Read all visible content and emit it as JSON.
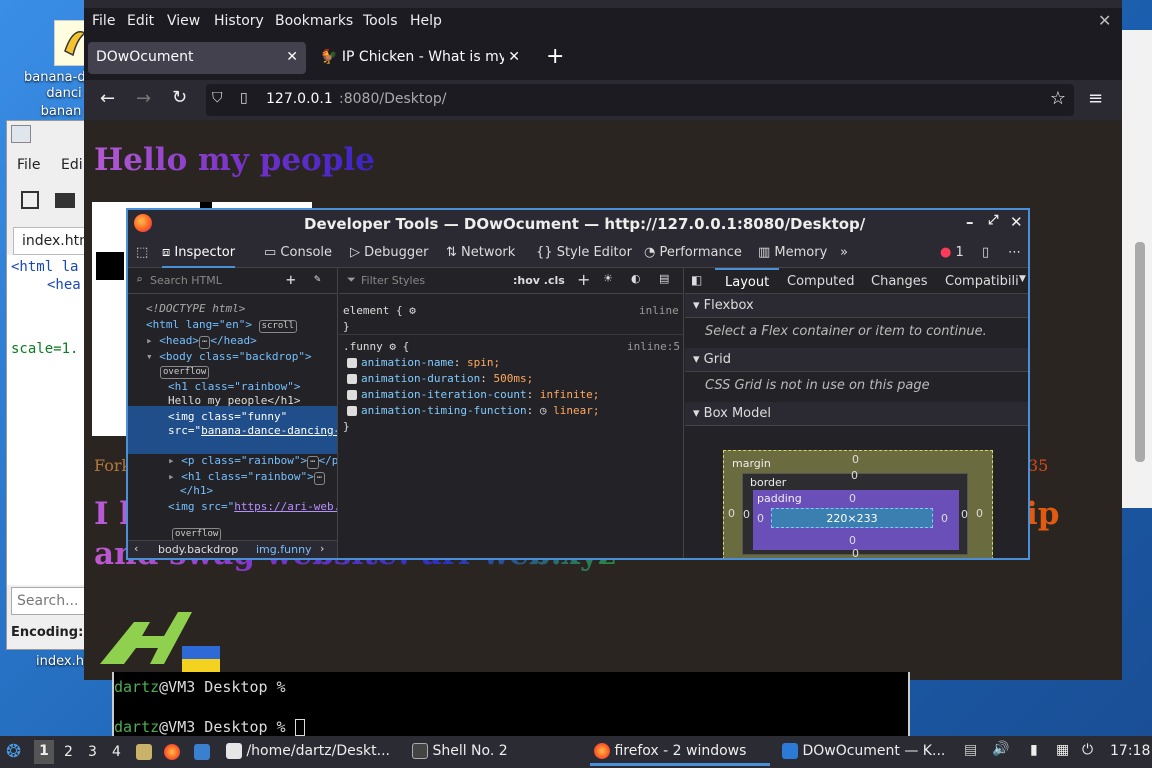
{
  "desktop": {
    "icon_label_1": "banana-dance-",
    "icon_label_2": "danci",
    "icon_label_3": "banan"
  },
  "kate": {
    "menu_file": "File",
    "menu_edit": "Edi",
    "tab_label": "index.htm",
    "code_line_1": "<html la",
    "code_line_2": "<hea",
    "code_line_3": "scale=1.",
    "search_placeholder": "Search...",
    "encoding_label": "Encoding:",
    "bottom_label": "index.htm"
  },
  "firefox": {
    "menu": [
      "File",
      "Edit",
      "View",
      "History",
      "Bookmarks",
      "Tools",
      "Help"
    ],
    "tabs": [
      {
        "label": "DOwOcument"
      },
      {
        "label": "IP Chicken - What is my I"
      }
    ],
    "url_host": "127.0.0.1",
    "url_rest": ":8080/Desktop/",
    "page": {
      "heading": "Hello my people",
      "fork_text": "Fork",
      "fork_suffix": "35",
      "big_text_left": "I l",
      "big_text_right": "ip",
      "bottom_text": "and swag website! ari-web.xyz"
    }
  },
  "devtools": {
    "title": "Developer Tools — DOwOcument — http://127.0.0.1:8080/Desktop/",
    "tabs": [
      "Inspector",
      "Console",
      "Debugger",
      "Network",
      "Style Editor",
      "Performance",
      "Memory"
    ],
    "error_count": "1",
    "search_html_placeholder": "Search HTML",
    "filter_styles_placeholder": "Filter Styles",
    "hov_cls": ":hov .cls",
    "layout_tabs": [
      "Layout",
      "Computed",
      "Changes",
      "Compatibili"
    ],
    "html_tree": {
      "doctype": "<!DOCTYPE html>",
      "html_open": "<html lang=\"en\">",
      "scroll_badge": "scroll",
      "head": "<head>",
      "head_close": "</head>",
      "body_open": "<body class=\"backdrop\">",
      "overflow_badge": "overflow",
      "h1_open": "<h1 class=\"rainbow\">",
      "h1_text": "Hello my people</h1>",
      "img_open": "<img class=\"funny\"",
      "img_src_attr": "src=\"",
      "img_src_value": "banana-dance-dancing-banana.gif",
      "img_close": "\">",
      "p_line": "<p class=\"rainbow\">",
      "p_close": "</p>",
      "h1b_line": "<h1 class=\"rainbow\">",
      "h1b_close": "</h1>",
      "img2_attr": "<img src=\"",
      "img2_value": "https://ari-web.xyz/favicon.ico",
      "img2_close": "\">",
      "overflow_badge_2": "overflow"
    },
    "breadcrumbs": [
      "body.backdrop",
      "img.funny"
    ],
    "rules": {
      "element_selector": "element {",
      "element_source": "inline",
      "close_brace": "}",
      "funny_selector": ".funny",
      "funny_source": "inline:5",
      "declarations": [
        {
          "prop": "animation-name",
          "value": "spin;"
        },
        {
          "prop": "animation-duration",
          "value": "500ms;"
        },
        {
          "prop": "animation-iteration-count",
          "value": "infinite;"
        },
        {
          "prop": "animation-timing-function",
          "value": "linear;"
        }
      ]
    },
    "layout": {
      "flexbox_label": "Flexbox",
      "flexbox_msg": "Select a Flex container or item to continue.",
      "grid_label": "Grid",
      "grid_msg": "CSS Grid is not in use on this page",
      "boxmodel_label": "Box Model",
      "margin_label": "margin",
      "border_label": "border",
      "padding_label": "padding",
      "content_size": "220×233",
      "zero": "0"
    }
  },
  "terminal": {
    "user": "dartz",
    "prompt_rest": "@VM3 Desktop %",
    "cursor": " "
  },
  "taskbar": {
    "workspaces": [
      "1",
      "2",
      "3",
      "4"
    ],
    "items": [
      {
        "label": "/home/dartz/Deskt..."
      },
      {
        "label": "Shell No. 2"
      },
      {
        "label": "firefox - 2 windows"
      },
      {
        "label": "DOwOcument — K..."
      }
    ],
    "clock": "17:18"
  }
}
